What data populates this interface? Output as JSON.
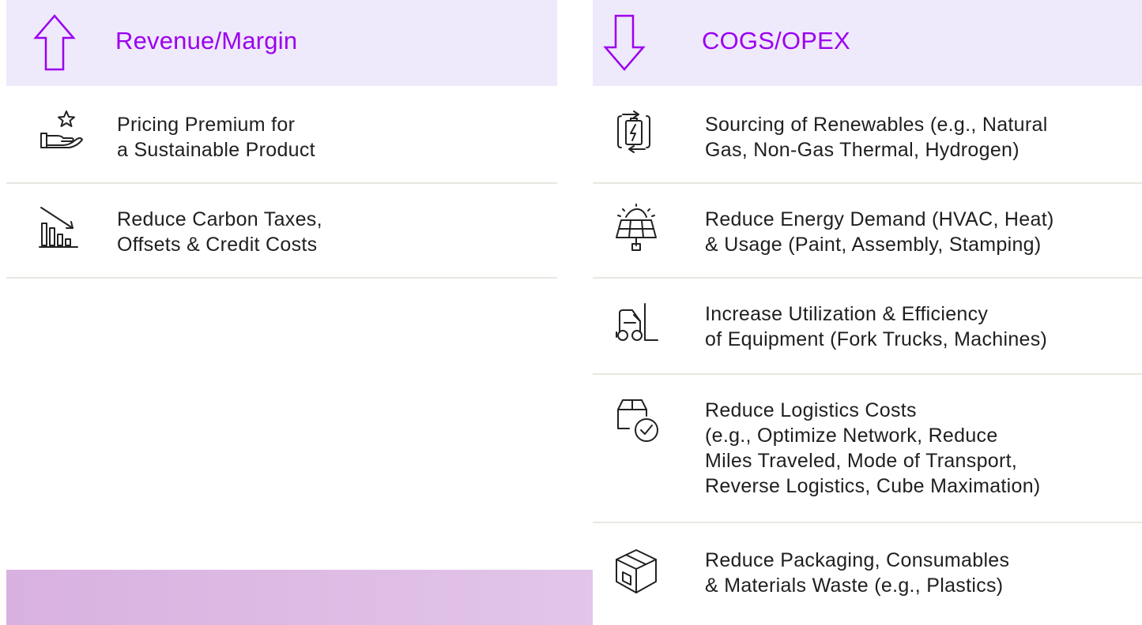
{
  "colors": {
    "accent": "#9b00ee",
    "header_bg": "#efe9fc",
    "divider": "#e8e7e1",
    "banner": "#d8b1e0"
  },
  "left": {
    "header": {
      "arrow_icon": "up-arrow-icon",
      "title": "Revenue/Margin"
    },
    "items": [
      {
        "icon": "hand-star-icon",
        "lines": [
          "Pricing Premium for",
          "a Sustainable Product"
        ]
      },
      {
        "icon": "declining-bar-chart-icon",
        "lines": [
          "Reduce Carbon Taxes,",
          "Offsets & Credit Costs"
        ]
      }
    ]
  },
  "right": {
    "header": {
      "arrow_icon": "down-arrow-icon",
      "title": "COGS/OPEX"
    },
    "items": [
      {
        "icon": "renewable-battery-icon",
        "lines": [
          "Sourcing of Renewables (e.g., Natural",
          "Gas, Non-Gas Thermal, Hydrogen)"
        ]
      },
      {
        "icon": "solar-panel-icon",
        "lines": [
          "Reduce Energy Demand (HVAC, Heat)",
          "& Usage (Paint, Assembly, Stamping)"
        ]
      },
      {
        "icon": "forklift-icon",
        "lines": [
          "Increase Utilization & Efficiency",
          "of Equipment (Fork Trucks, Machines)"
        ]
      },
      {
        "icon": "box-check-icon",
        "lines": [
          "Reduce Logistics Costs",
          "(e.g., Optimize Network, Reduce",
          "Miles Traveled, Mode of Transport,",
          "Reverse Logistics, Cube Maximation)"
        ]
      },
      {
        "icon": "package-icon",
        "lines": [
          "Reduce Packaging, Consumables",
          "& Materials Waste (e.g., Plastics)"
        ]
      }
    ]
  }
}
